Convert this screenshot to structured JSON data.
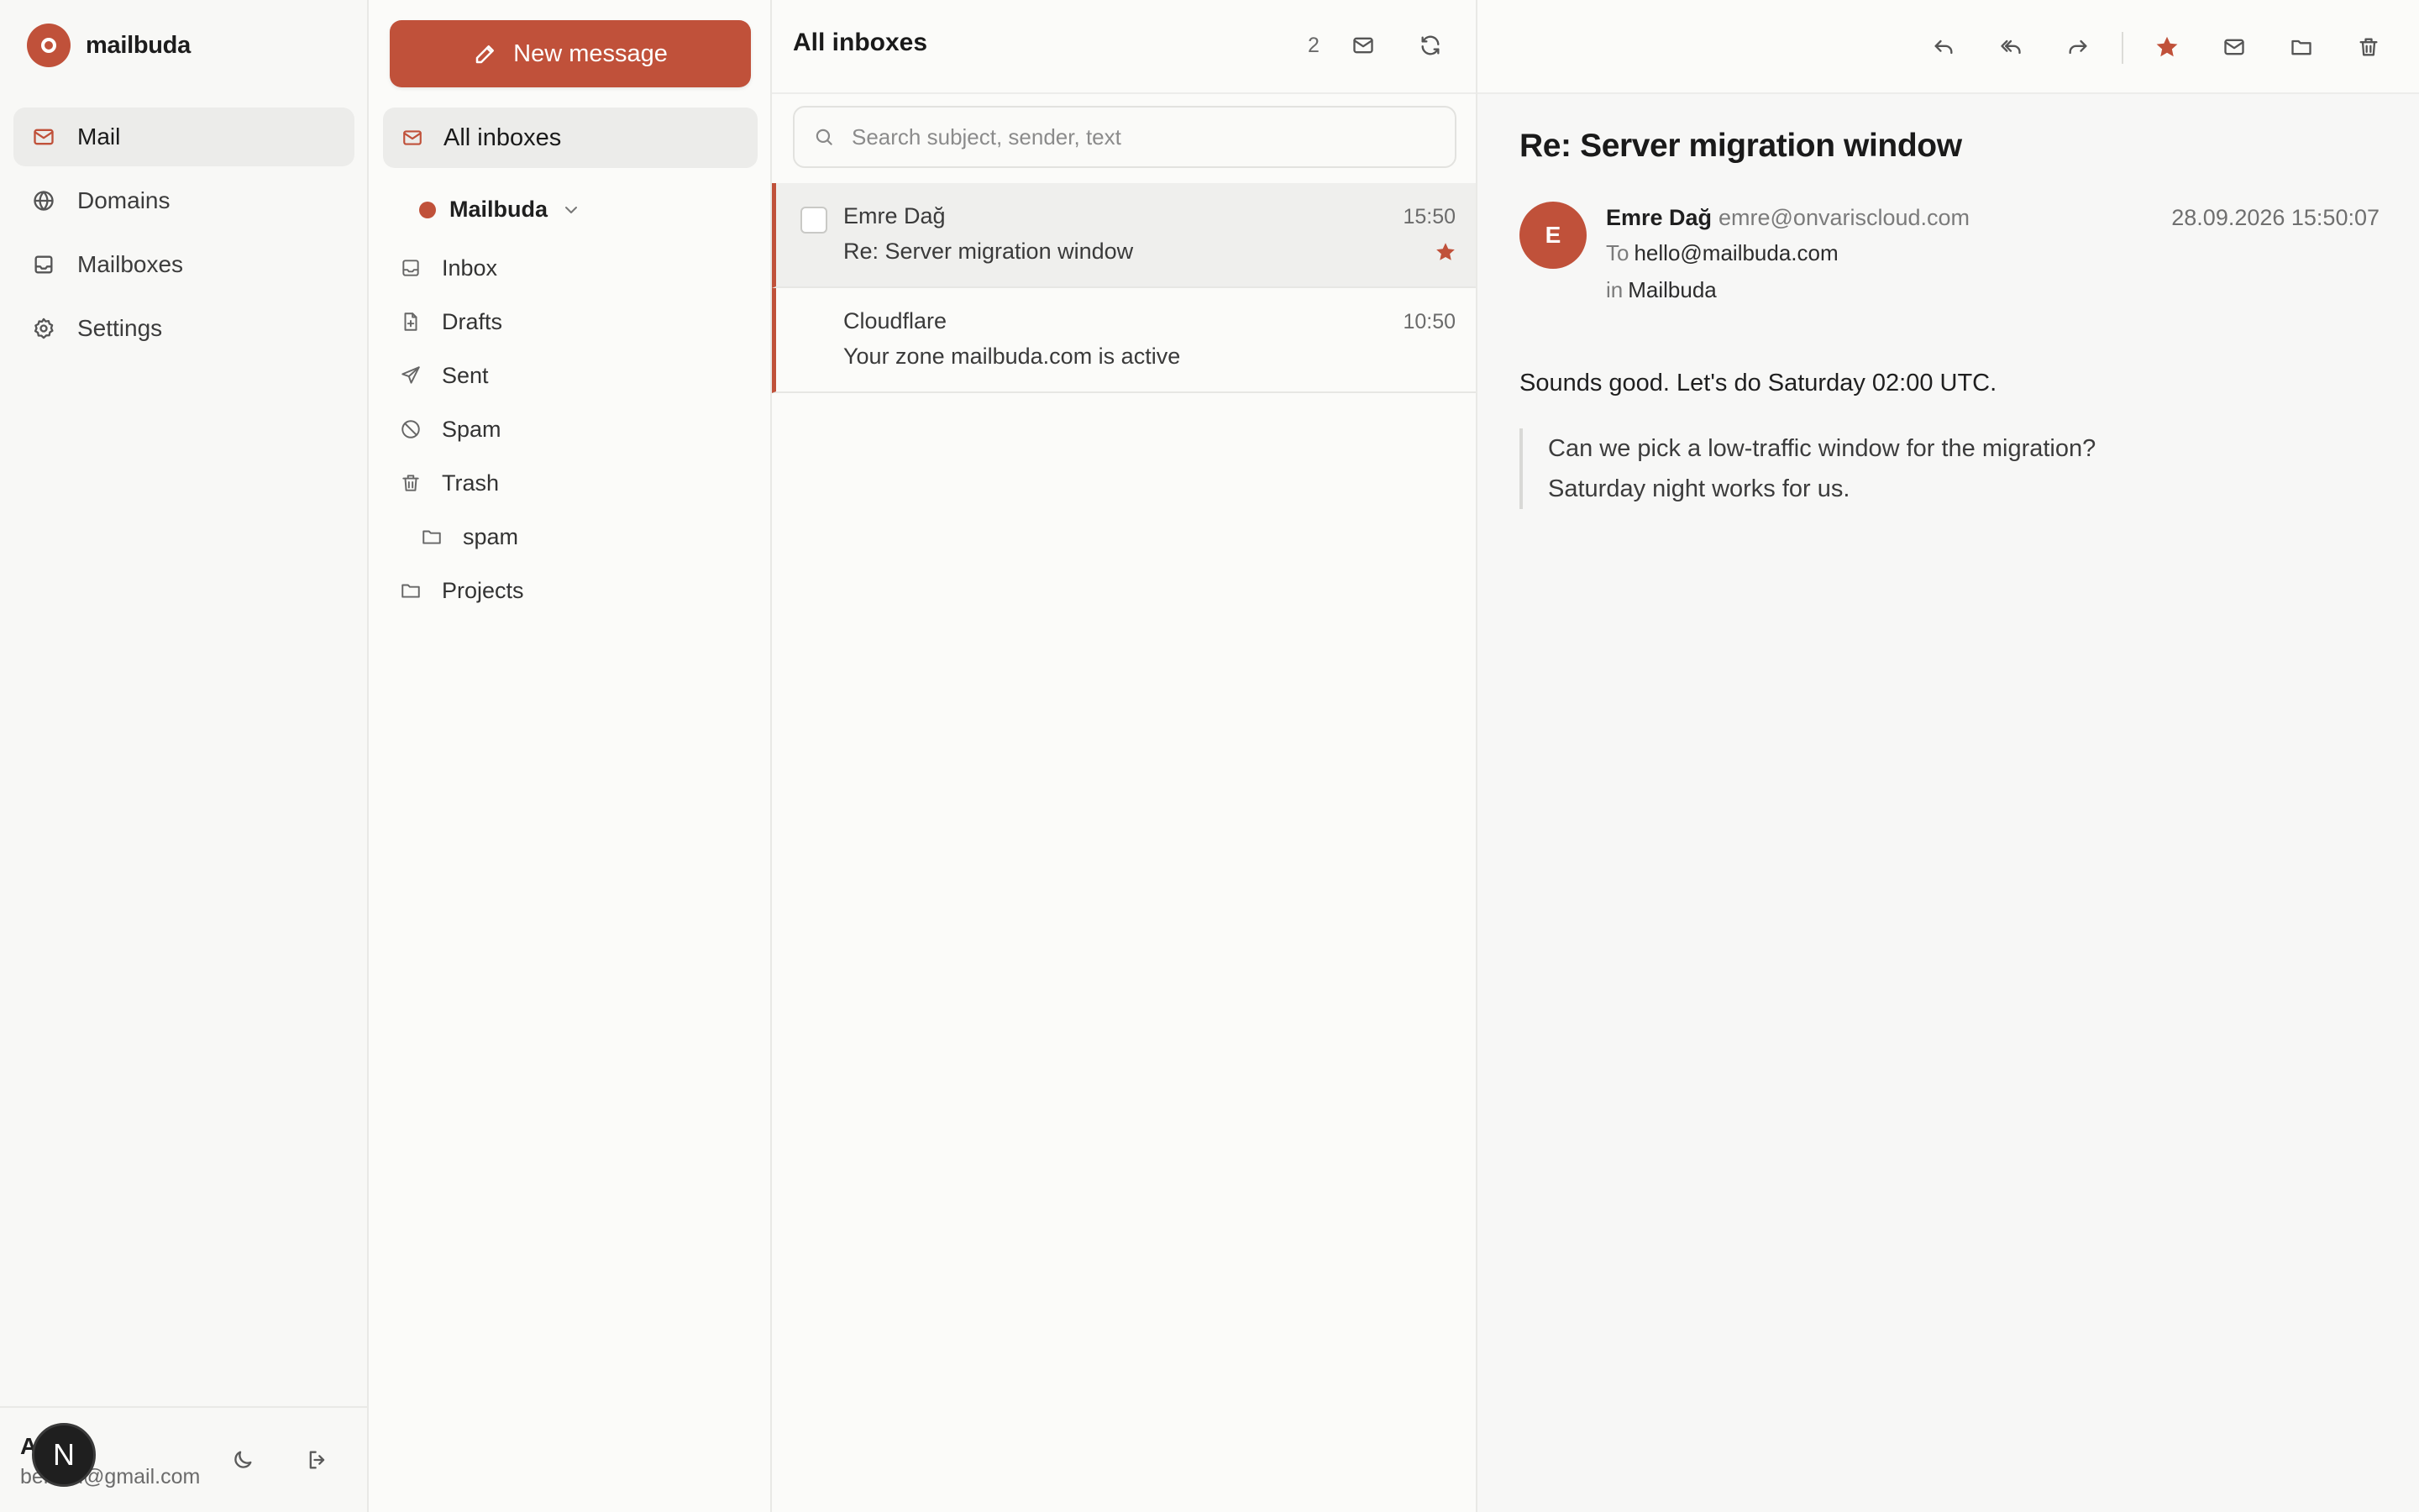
{
  "app": {
    "brand_name": "mailbuda",
    "accent_color": "#c0513a"
  },
  "nav": {
    "items": [
      {
        "label": "Mail",
        "icon": "mail-icon",
        "active": true
      },
      {
        "label": "Domains",
        "icon": "globe-icon",
        "active": false
      },
      {
        "label": "Mailboxes",
        "icon": "inbox-icon",
        "active": false
      },
      {
        "label": "Settings",
        "icon": "gear-icon",
        "active": false
      }
    ],
    "user": {
      "initial": "A",
      "email": "berkcu@gmail.com",
      "avatar_letter": "N"
    }
  },
  "folders": {
    "compose_label": "New message",
    "all_inboxes_label": "All inboxes",
    "account_name": "Mailbuda",
    "items": [
      {
        "label": "Inbox",
        "icon": "inbox-icon"
      },
      {
        "label": "Drafts",
        "icon": "draft-file-icon"
      },
      {
        "label": "Sent",
        "icon": "send-icon"
      },
      {
        "label": "Spam",
        "icon": "ban-icon"
      },
      {
        "label": "Trash",
        "icon": "trash-icon"
      },
      {
        "label": "spam",
        "icon": "folder-icon"
      },
      {
        "label": "Projects",
        "icon": "folder-icon"
      }
    ]
  },
  "list": {
    "title": "All inboxes",
    "count": "2",
    "search_placeholder": "Search subject, sender, text",
    "messages": [
      {
        "sender": "Emre Dağ",
        "subject": "Re: Server migration window",
        "time": "15:50",
        "starred": true,
        "selected": true
      },
      {
        "sender": "Cloudflare",
        "subject": "Your zone mailbuda.com is active",
        "time": "10:50",
        "starred": false,
        "selected": false
      }
    ]
  },
  "reader": {
    "subject": "Re: Server migration window",
    "avatar_letter": "E",
    "from_name": "Emre Dağ",
    "from_email": "emre@onvariscloud.com",
    "date": "28.09.2026 15:50:07",
    "to_label": "To",
    "to_address": "hello@mailbuda.com",
    "in_label": "in",
    "in_mailbox": "Mailbuda",
    "body": "Sounds good. Let's do Saturday 02:00 UTC.",
    "quote_lines": [
      "Can we pick a low-traffic window for the migration?",
      "Saturday night works for us."
    ]
  }
}
